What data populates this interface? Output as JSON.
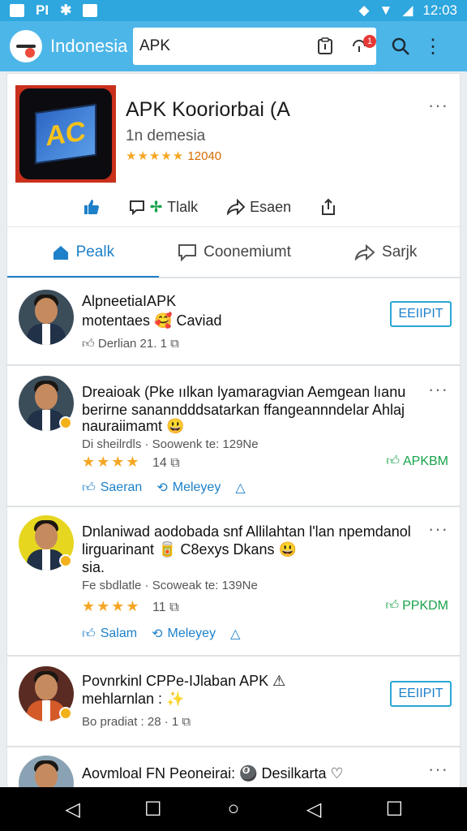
{
  "status": {
    "left_text": "PI",
    "time": "12:03"
  },
  "app_bar": {
    "brand": "Indonesia",
    "search_value": "APK",
    "badge_count": "1"
  },
  "app": {
    "title": "APK Kooriorbai (A",
    "subtitle": "1n demesia",
    "stars": "★★★★★",
    "rating_count": "12040",
    "icon_text": "AC",
    "actions": {
      "talk_label": "Tlalk",
      "share_label": "Esaen"
    }
  },
  "tabs": [
    {
      "label": "Pealk",
      "active": true
    },
    {
      "label": "Coonemiumt",
      "active": false
    },
    {
      "label": "Sarjk",
      "active": false
    }
  ],
  "posts": [
    {
      "title": "AlpneetiaIAPK",
      "line1": "motentaes 🥰 Caviad",
      "meta": "Derlian  21.  1",
      "button": "EEIIPIT"
    },
    {
      "title": "Dreaioak (Pke ıılkan lyamaragvian Aemgean lıanu",
      "line1": "berirne sananndddsatarkan ffangeannndelar Ahlaj",
      "line2": "nauraiimamt 😃",
      "meta": "Di sheilrdls · Soowenk te: 129Ne",
      "stars": "★★★★",
      "count": "14",
      "tag": "APKBM",
      "action1": "Saeran",
      "action2": "Meleyey"
    },
    {
      "title": "Dnlaniwad aodobada snf Allilahtan l'lan npemdanol",
      "line1": "lirguarinant 🥫 C8exys Dkans 😃",
      "line2": "sia.",
      "meta": "Fe sbdlatle · Scoweak te: 139Ne",
      "stars": "★★★★",
      "count": "11",
      "tag": "PPKDM",
      "action1": "Salam",
      "action2": "Meleyey"
    },
    {
      "title": "Povnrkinl CPPe-IJlaban APK ⚠",
      "line1": "mehlarnlan : ✨",
      "meta": "Bo pradiat : 28 · 1",
      "button": "EEIIPIT"
    },
    {
      "title": "Aovmloal FN Peoneirai: 🎱 Desilkarta ♡"
    }
  ]
}
